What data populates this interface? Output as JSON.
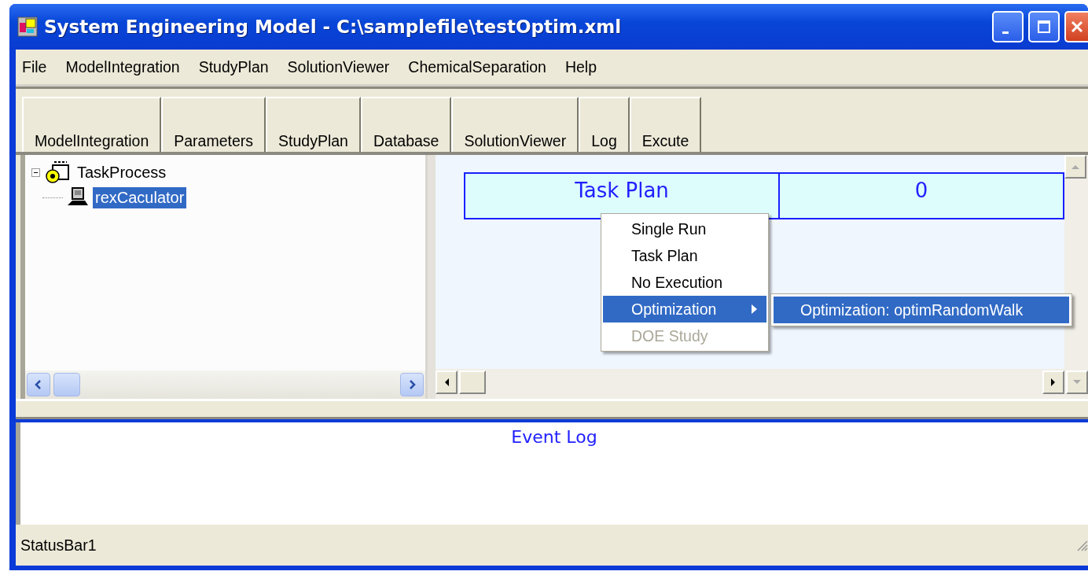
{
  "window": {
    "title": "System Engineering Model - C:\\samplefile\\testOptim.xml"
  },
  "menu_bar": [
    "File",
    "ModelIntegration",
    "StudyPlan",
    "SolutionViewer",
    "ChemicalSeparation",
    "Help"
  ],
  "toolbar_tabs": [
    "ModelIntegration",
    "Parameters",
    "StudyPlan",
    "Database",
    "SolutionViewer",
    "Log",
    "Excute"
  ],
  "tree": [
    {
      "label": "TaskProcess",
      "kind": "process",
      "expanded": true,
      "selected": false,
      "children": [
        {
          "label": "rexCaculator",
          "kind": "computer",
          "selected": true
        }
      ]
    }
  ],
  "plan_grid": {
    "cells": [
      "Task Plan",
      "0"
    ]
  },
  "context_menu": {
    "items": [
      {
        "label": "Single Run",
        "selected": false,
        "disabled": false,
        "submenu": false
      },
      {
        "label": "Task Plan",
        "selected": false,
        "disabled": false,
        "submenu": false
      },
      {
        "label": "No Execution",
        "selected": false,
        "disabled": false,
        "submenu": false
      },
      {
        "label": "Optimization",
        "selected": true,
        "disabled": false,
        "submenu": true
      },
      {
        "label": "DOE Study",
        "selected": false,
        "disabled": true,
        "submenu": false
      }
    ],
    "submenu_items": [
      {
        "label": "Optimization: optimRandomWalk",
        "selected": true
      }
    ]
  },
  "event_log": {
    "title": "Event Log"
  },
  "status_bar": {
    "text": "StatusBar1"
  }
}
